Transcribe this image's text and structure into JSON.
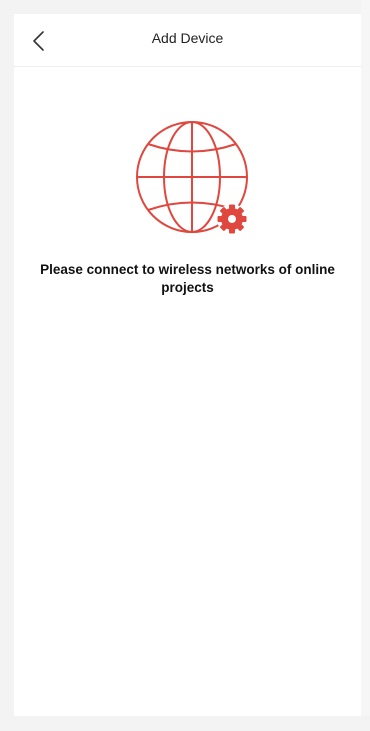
{
  "header": {
    "title": "Add Device",
    "back_icon": "chevron-left-icon"
  },
  "illustration": {
    "globe_icon": "globe-icon",
    "badge_icon": "gear-icon",
    "accent_color": "#e0473f"
  },
  "message": {
    "text": "Please connect to wireless networks of online projects"
  }
}
